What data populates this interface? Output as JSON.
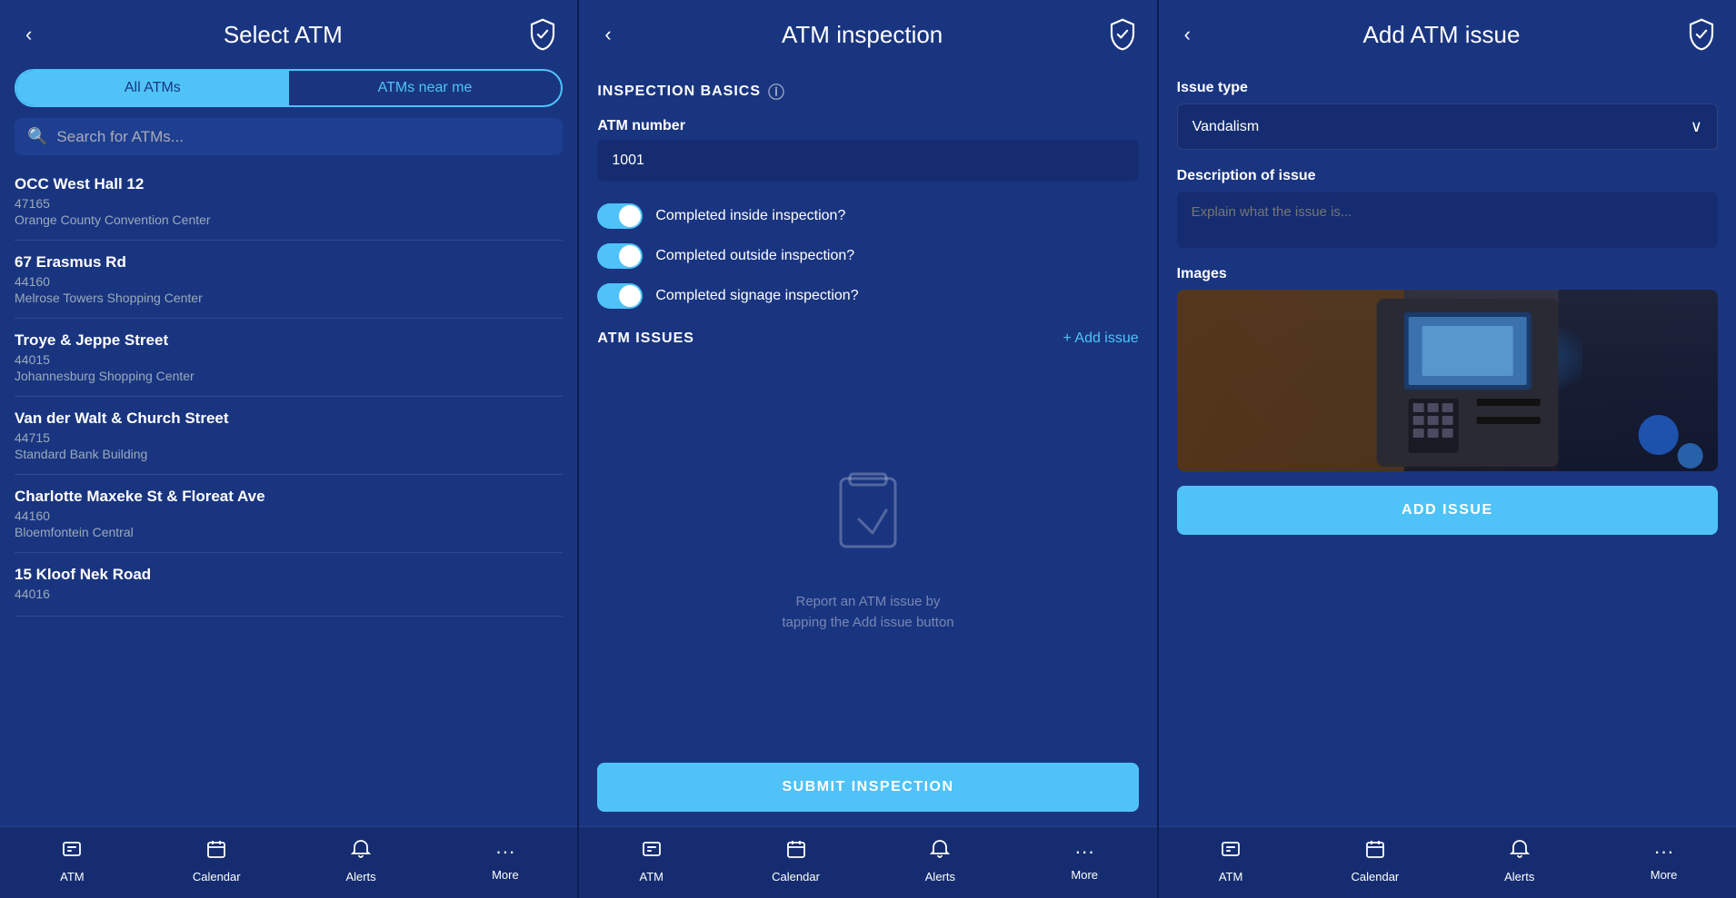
{
  "screens": [
    {
      "id": "select-atm",
      "header": {
        "title": "Select ATM",
        "back_arrow": "‹"
      },
      "tabs": [
        {
          "id": "all-atms",
          "label": "All ATMs",
          "active": true
        },
        {
          "id": "atms-near-me",
          "label": "ATMs near me",
          "active": false
        }
      ],
      "search": {
        "placeholder": "Search for ATMs..."
      },
      "atm_list": [
        {
          "name": "OCC West Hall 12",
          "code": "47165",
          "location": "Orange County Convention Center"
        },
        {
          "name": "67 Erasmus Rd",
          "code": "44160",
          "location": "Melrose Towers Shopping Center"
        },
        {
          "name": "Troye & Jeppe Street",
          "code": "44015",
          "location": "Johannesburg Shopping Center"
        },
        {
          "name": "Van der Walt & Church Street",
          "code": "44715",
          "location": "Standard Bank Building"
        },
        {
          "name": "Charlotte Maxeke St & Floreat Ave",
          "code": "44160",
          "location": "Bloemfontein Central"
        },
        {
          "name": "15 Kloof Nek Road",
          "code": "44016",
          "location": ""
        }
      ],
      "nav": [
        {
          "label": "ATM",
          "icon": "atm"
        },
        {
          "label": "Calendar",
          "icon": "calendar"
        },
        {
          "label": "Alerts",
          "icon": "bell"
        },
        {
          "label": "More",
          "icon": "more"
        }
      ]
    },
    {
      "id": "atm-inspection",
      "header": {
        "title": "ATM inspection",
        "back_arrow": "‹"
      },
      "section_basics": "INSPECTION BASICS",
      "atm_number_label": "ATM number",
      "atm_number_value": "1001",
      "toggles": [
        {
          "label": "Completed inside inspection?",
          "checked": true
        },
        {
          "label": "Completed outside inspection?",
          "checked": true
        },
        {
          "label": "Completed signage inspection?",
          "checked": true
        }
      ],
      "issues_section": "ATM ISSUES",
      "add_issue_label": "+ Add issue",
      "empty_state_text": "Report an ATM issue by\ntapping the Add issue button",
      "submit_btn": "SUBMIT INSPECTION",
      "nav": [
        {
          "label": "ATM",
          "icon": "atm"
        },
        {
          "label": "Calendar",
          "icon": "calendar"
        },
        {
          "label": "Alerts",
          "icon": "bell"
        },
        {
          "label": "More",
          "icon": "more"
        }
      ]
    },
    {
      "id": "add-atm-issue",
      "header": {
        "title": "Add ATM issue",
        "back_arrow": "‹"
      },
      "issue_type_label": "Issue type",
      "issue_type_value": "Vandalism",
      "description_label": "Description of issue",
      "description_placeholder": "Explain what the issue is...",
      "images_label": "Images",
      "add_issue_btn": "ADD ISSUE",
      "nav": [
        {
          "label": "ATM",
          "icon": "atm"
        },
        {
          "label": "Calendar",
          "icon": "calendar"
        },
        {
          "label": "Alerts",
          "icon": "bell"
        },
        {
          "label": "More",
          "icon": "more"
        }
      ]
    }
  ],
  "colors": {
    "primary_dark": "#1a3580",
    "primary_light": "#4fc3f7",
    "nav_bg": "#152d70",
    "input_bg": "#152d70",
    "text_white": "#ffffff",
    "text_muted": "#9aabbf"
  }
}
